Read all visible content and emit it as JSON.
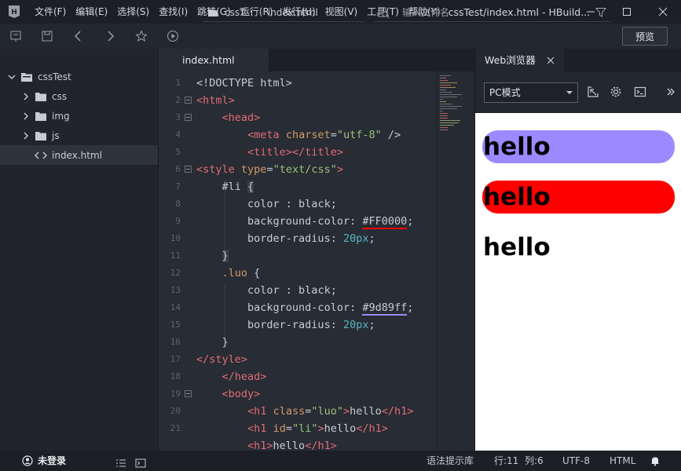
{
  "window": {
    "menu": [
      "文件(F)",
      "编辑(E)",
      "选择(S)",
      "查找(I)",
      "跳转(G)",
      "运行(R)",
      "发行(U)",
      "视图(V)",
      "工具(T)",
      "帮助(Y)"
    ],
    "title": "cssTest/index.html - HBuild..."
  },
  "toolbar": {
    "breadcrumb_project": "cssT...",
    "breadcrumb_file": "index.html",
    "file_search_placeholder": "输入文件名",
    "preview_label": "预览"
  },
  "sidebar": {
    "project": "cssTest",
    "items": [
      {
        "label": "css",
        "type": "folder"
      },
      {
        "label": "img",
        "type": "folder"
      },
      {
        "label": "js",
        "type": "folder"
      },
      {
        "label": "index.html",
        "type": "file",
        "active": true
      }
    ]
  },
  "editor": {
    "tab_label": "index.html",
    "line_numbers": [
      "1",
      "2",
      "3",
      "4",
      "5",
      "6",
      "7",
      "8",
      "9",
      "10",
      "11",
      "12",
      "13",
      "14",
      "15",
      "16",
      "17",
      "18",
      "19",
      "20",
      "21"
    ]
  },
  "browser": {
    "tab_label": "Web浏览器",
    "mode": "PC模式",
    "headings": [
      {
        "text": "hello",
        "background": "#9d89ff"
      },
      {
        "text": "hello",
        "background": "#FF0000"
      },
      {
        "text": "hello",
        "background": ""
      }
    ]
  },
  "status": {
    "user": "未登录",
    "syntax_hint": "语法提示库",
    "line": "行:11",
    "column": "列:6",
    "encoding": "UTF-8",
    "language": "HTML"
  },
  "colors": {
    "editor_bg": "#282c34",
    "tag": "#e06c75",
    "attr": "#d19a66",
    "string": "#98c379",
    "number": "#56b6c2"
  }
}
